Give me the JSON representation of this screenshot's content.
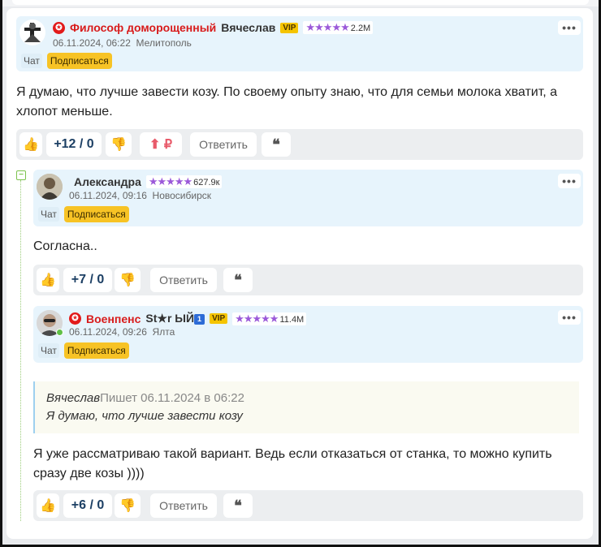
{
  "comments": [
    {
      "rank": "Философ доморощенный",
      "username": "Вячеслав",
      "vip": "VIP",
      "stars": "★★★★★",
      "rating": "2.2M",
      "date": "06.11.2024, 06:22",
      "city": "Мелитополь",
      "chat": "Чат",
      "subscribe": "Подписаться",
      "text": "Я думаю, что лучше завести козу. По своему опыту знаю, что для семьи молока хватит, а хлопот меньше.",
      "score": "+12 / 0",
      "donate": "⬆ ₽",
      "reply": "Ответить"
    },
    {
      "username": "Александра",
      "stars": "★★★★★",
      "rating": "627.9к",
      "date": "06.11.2024, 09:16",
      "city": "Новосибирск",
      "chat": "Чат",
      "subscribe": "Подписаться",
      "text": "Согласна..",
      "score": "+7 / 0",
      "reply": "Ответить"
    },
    {
      "rank": "Военпенс",
      "username": "St★r ЫЙ",
      "flag": "1",
      "vip": "VIP",
      "stars": "★★★★★",
      "rating": "11.4M",
      "date": "06.11.2024, 09:26",
      "city": "Ялта",
      "chat": "Чат",
      "subscribe": "Подписаться",
      "quote_author": "Вячеслав",
      "quote_meta": "Пишет 06.11.2024 в 06:22",
      "quote_text": "Я думаю, что лучше завести козу",
      "text": "Я уже рассматриваю такой вариант. Ведь если отказаться от станка, то можно купить сразу две козы ))))",
      "score": "+6 / 0",
      "reply": "Ответить"
    }
  ],
  "icons": {
    "more": "•••",
    "thumb_up": "👍",
    "thumb_down": "👎",
    "quote": "❝",
    "collapse": "−",
    "rank_badge": "✪"
  }
}
